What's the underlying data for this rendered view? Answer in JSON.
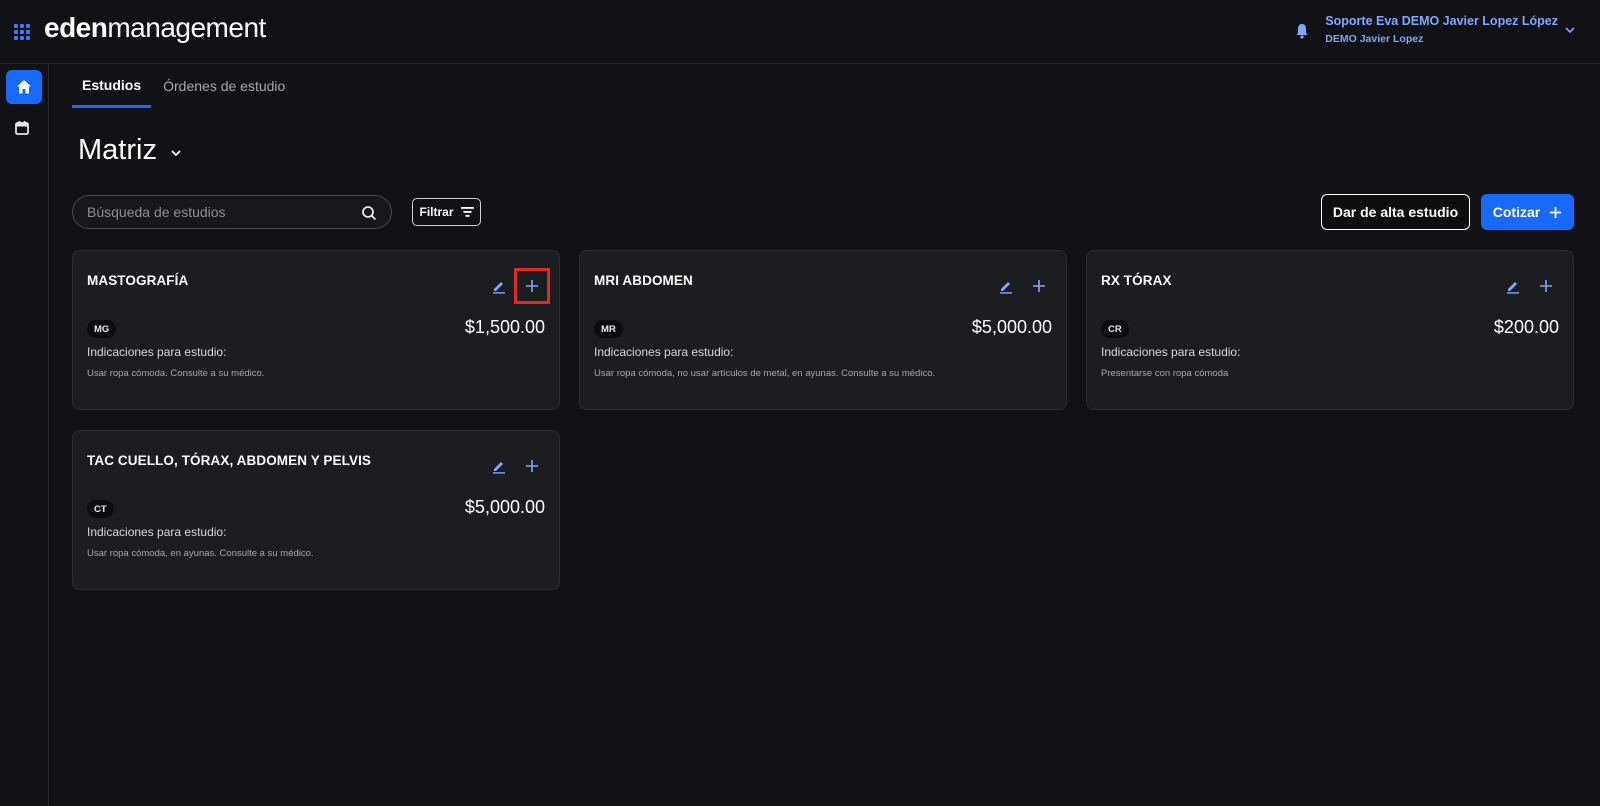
{
  "header": {
    "logo_bold": "eden",
    "logo_light": "management",
    "user_name": "Soporte Eva DEMO Javier Lopez López",
    "user_org": "DEMO Javier Lopez"
  },
  "tabs": [
    {
      "label": "Estudios",
      "active": true
    },
    {
      "label": "Órdenes de estudio",
      "active": false
    }
  ],
  "page": {
    "title": "Matriz"
  },
  "search": {
    "placeholder": "Búsqueda de estudios",
    "value": ""
  },
  "toolbar": {
    "filter_label": "Filtrar",
    "add_study_label": "Dar de alta estudio",
    "quote_label": "Cotizar"
  },
  "studies": [
    {
      "name": "MASTOGRAFÍA",
      "modality": "MG",
      "price": "$1,500.00",
      "indications_label": "Indicaciones para estudio:",
      "indications": "Usar ropa cómoda. Consulte a su médico."
    },
    {
      "name": "MRI ABDOMEN",
      "modality": "MR",
      "price": "$5,000.00",
      "indications_label": "Indicaciones para estudio:",
      "indications": "Usar ropa cómoda, no usar artículos de metal, en ayunas. Consulte a su médico."
    },
    {
      "name": "RX TÓRAX",
      "modality": "CR",
      "price": "$200.00",
      "indications_label": "Indicaciones para estudio:",
      "indications": "Presentarse con ropa cómoda"
    },
    {
      "name": "TAC CUELLO, TÓRAX, ABDOMEN Y PELVIS",
      "modality": "CT",
      "price": "$5,000.00",
      "indications_label": "Indicaciones para estudio:",
      "indications": "Usar ropa cómoda, en ayunas. Consulte a su médico."
    }
  ],
  "colors": {
    "background": "#111215",
    "card": "#1b1d21",
    "accent": "#1769ff",
    "user_text": "#7fa8ff",
    "highlight": "#e02b20"
  },
  "icons": [
    "apps-grid-icon",
    "bell-icon",
    "chevron-down-icon",
    "home-icon",
    "calendar-icon",
    "search-icon",
    "filter-icon",
    "plus-icon",
    "edit-icon"
  ]
}
